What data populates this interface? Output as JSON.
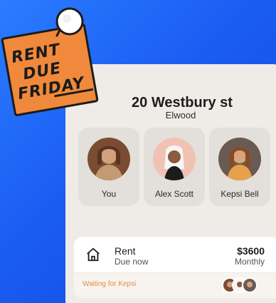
{
  "note": {
    "lines": [
      "RENT",
      "DUE",
      "FRIDAY"
    ]
  },
  "property": {
    "address": "20 Westbury st",
    "suburb": "Elwood"
  },
  "tenants": [
    {
      "name": "You"
    },
    {
      "name": "Alex Scott"
    },
    {
      "name": "Kepsi Bell"
    }
  ],
  "rent": {
    "label": "Rent",
    "status": "Due now",
    "amount": "$3600",
    "frequency": "Monthly",
    "waiting_text": "Waiting for Kepsi"
  },
  "colors": {
    "background": "#1a5cf2",
    "note": "#f0893b",
    "card": "#efece7",
    "waiting": "#e58b3d"
  }
}
